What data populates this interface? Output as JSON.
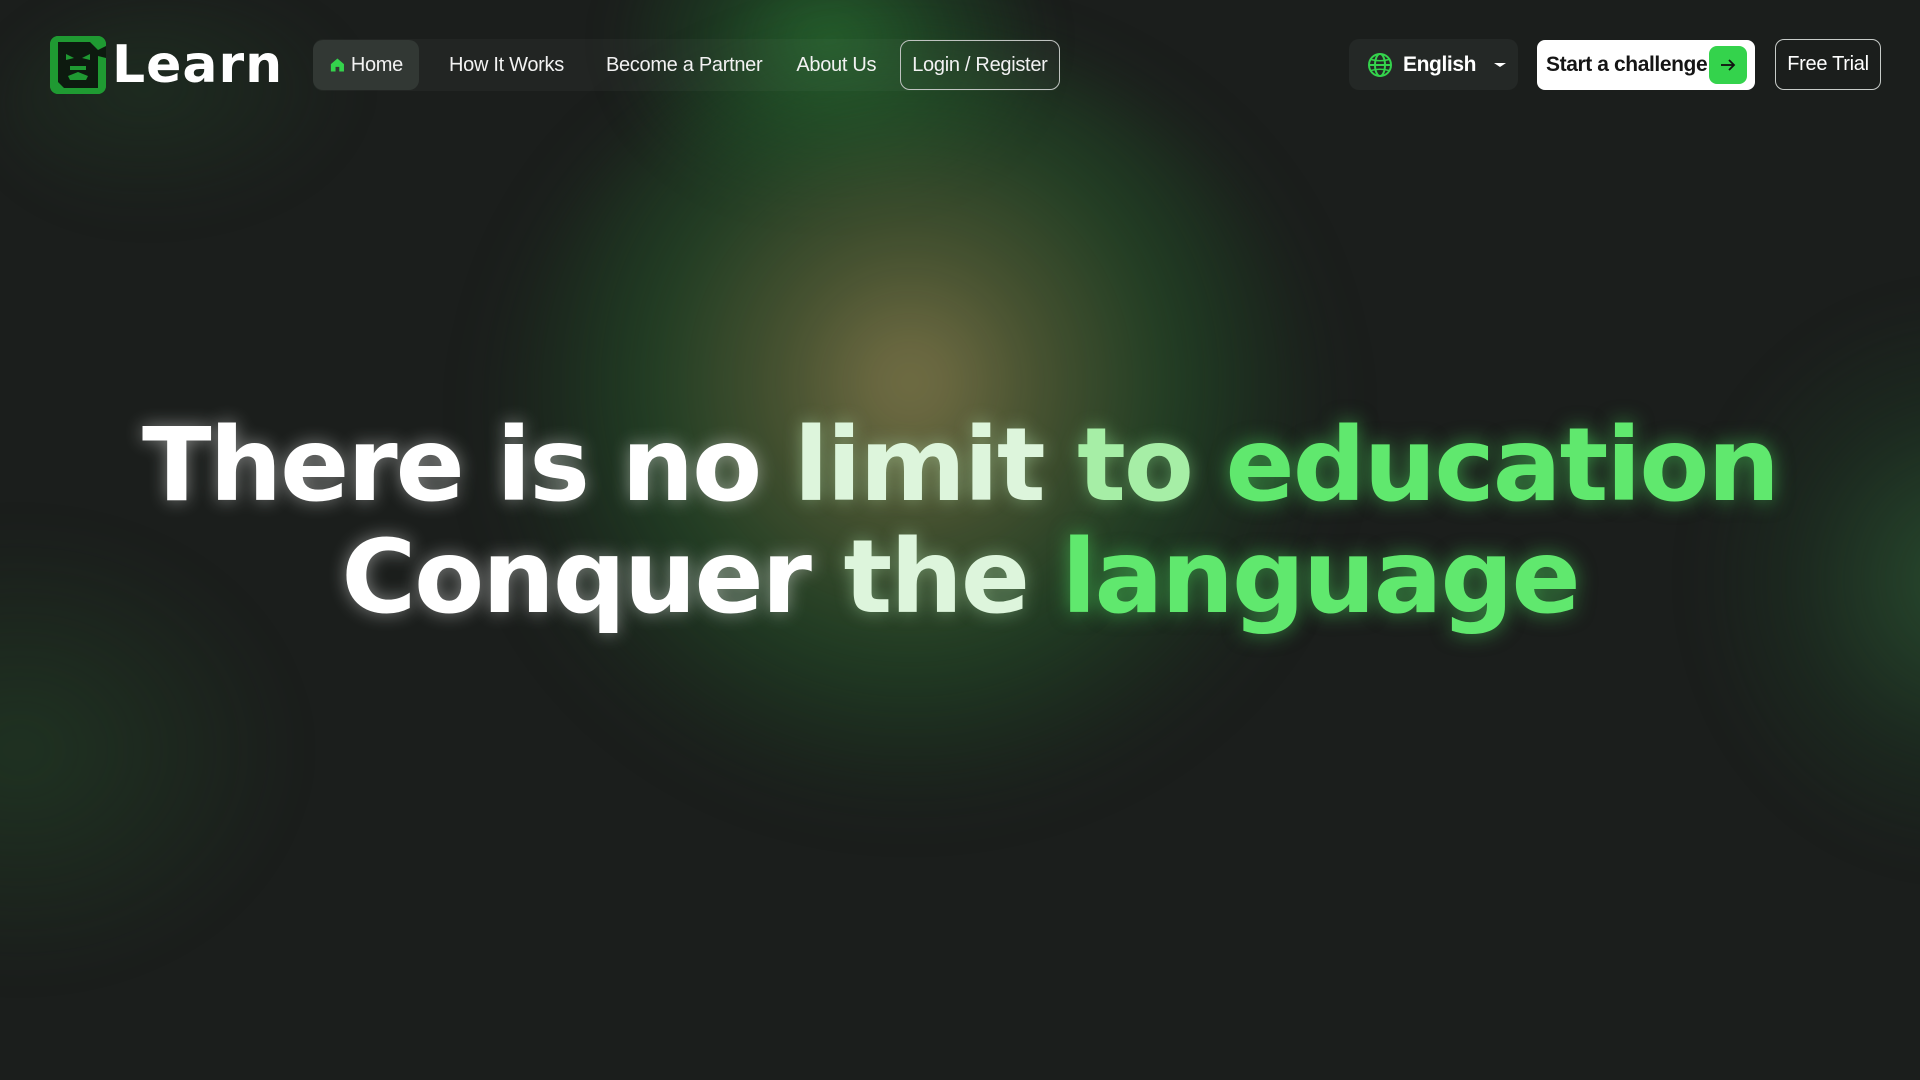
{
  "header": {
    "logo_text": "Learn",
    "nav": [
      {
        "label": "Home",
        "active": true
      },
      {
        "label": "How It Works"
      },
      {
        "label": "Become a Partner"
      },
      {
        "label": "About Us"
      },
      {
        "label": "Login / Register",
        "outlined": true
      }
    ],
    "language": {
      "label": "English",
      "icon": "globe-icon"
    },
    "start_challenge_label": "Start a challenge",
    "free_trial_label": "Free Trial"
  },
  "hero": {
    "line1": {
      "part1": "There is no",
      "part2": "limit",
      "part3": "to",
      "part4": "education"
    },
    "line2": {
      "part1": "Conquer",
      "part2": "the",
      "part3": "language"
    }
  },
  "colors": {
    "background": "#1b1e1c",
    "accent_green": "#34d34c",
    "hero_green": "#60e86e"
  }
}
